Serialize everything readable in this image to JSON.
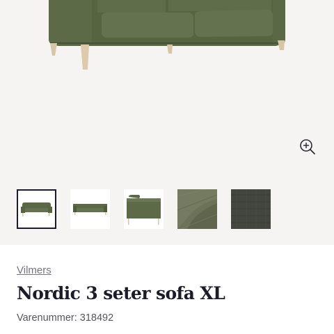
{
  "gallery": {
    "main_image_alt": "",
    "zoom_icon": "zoom-in-icon",
    "selected_thumbnail": 1,
    "thumbnails": [
      {
        "name": "thumbnail-sofa-angle"
      },
      {
        "name": "thumbnail-sofa-front"
      },
      {
        "name": "thumbnail-sofa-side"
      },
      {
        "name": "thumbnail-fabric-closeup"
      },
      {
        "name": "thumbnail-fabric-swatch"
      }
    ]
  },
  "product": {
    "brand": "Vilmers",
    "title": "Nordic 3 seter sofa XL",
    "sku_label": "Varenummer: 318492"
  },
  "colors": {
    "sofa_green": "#5c6a4a",
    "sofa_green_dark": "#4a573a",
    "leg_wood": "#d9c7a8",
    "gallery_bg": "#f5f4f2",
    "text_dark": "#1b1b2a"
  }
}
